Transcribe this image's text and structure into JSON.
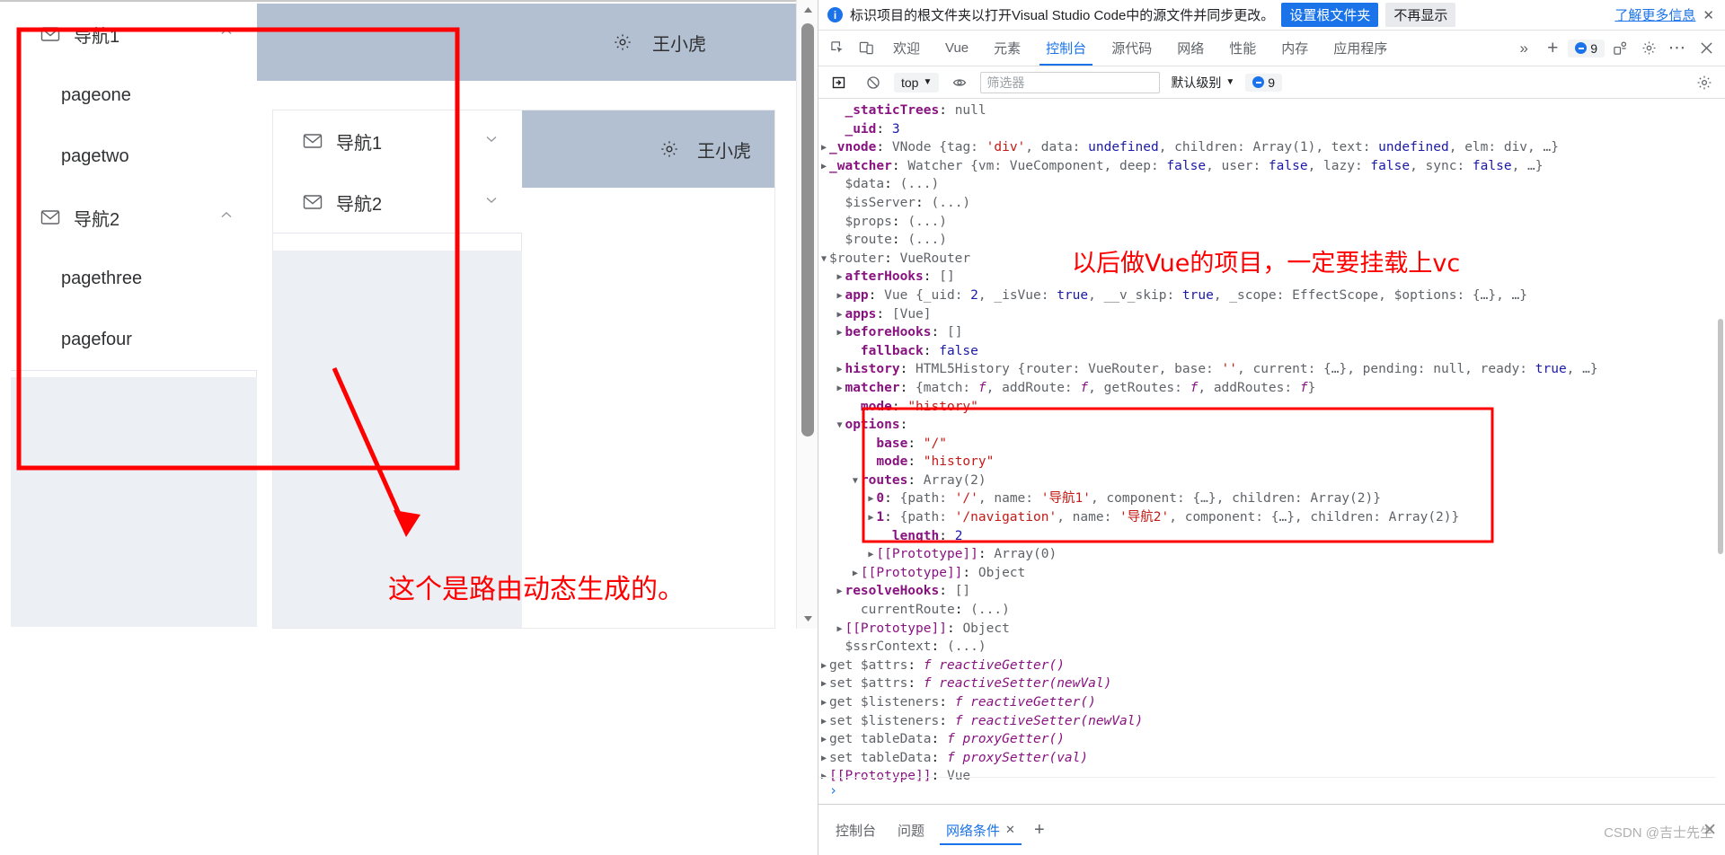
{
  "browser_page": {
    "outer_app": {
      "menu": [
        {
          "type": "group",
          "label": "导航1",
          "icon": "mail-icon",
          "arrow": "chevron-up-icon"
        },
        {
          "type": "leaf",
          "label": "pageone"
        },
        {
          "type": "leaf",
          "label": "pagetwo"
        },
        {
          "type": "group",
          "label": "导航2",
          "icon": "mail-icon",
          "arrow": "chevron-up-icon"
        },
        {
          "type": "leaf",
          "label": "pagethree"
        },
        {
          "type": "leaf",
          "label": "pagefour"
        }
      ],
      "header": {
        "gear_icon": "gear-icon",
        "user_name": "王小虎"
      }
    },
    "inner_app": {
      "menu": [
        {
          "type": "group",
          "label": "导航1",
          "icon": "mail-icon",
          "arrow": "chevron-down-icon"
        },
        {
          "type": "group",
          "label": "导航2",
          "icon": "mail-icon",
          "arrow": "chevron-down-icon"
        }
      ],
      "header": {
        "gear_icon": "gear-icon",
        "user_name": "王小虎"
      }
    },
    "annotations": {
      "dynamic_route_note": "这个是路由动态生成的。",
      "highlight_color": "#ff0000"
    }
  },
  "devtools": {
    "banner": {
      "info_icon": "info-icon",
      "message": "标识项目的根文件夹以打开Visual Studio Code中的源文件并同步更改。",
      "primary_button": "设置根文件夹",
      "secondary_button": "不再显示",
      "learn_more": "了解更多信息",
      "close": "✕"
    },
    "tabs": {
      "left_icons": [
        "inspect-icon",
        "device-toolbar-icon"
      ],
      "items": [
        {
          "label": "欢迎",
          "active": false
        },
        {
          "label": "Vue",
          "active": false
        },
        {
          "label": "元素",
          "active": false
        },
        {
          "label": "控制台",
          "active": true
        },
        {
          "label": "源代码",
          "active": false
        },
        {
          "label": "网络",
          "active": false
        },
        {
          "label": "性能",
          "active": false
        },
        {
          "label": "内存",
          "active": false
        },
        {
          "label": "应用程序",
          "active": false
        }
      ],
      "overflow": "»",
      "add": "+",
      "issues_count": "9",
      "right_icons": [
        "devices-icon",
        "settings-gear-icon",
        "more-dots-icon",
        "close-icon"
      ]
    },
    "console_toolbar": {
      "clear_icon": "clear-console-icon",
      "no_entry_icon": "no-entry-icon",
      "context": "top",
      "eye_icon": "live-expression-icon",
      "filter_placeholder": "筛选器",
      "filter_value": "",
      "level": "默认级别",
      "issues_count": "9",
      "settings_icon": "settings-gear-icon"
    },
    "console_lines": [
      {
        "indent": 1,
        "tri": "none",
        "key": "_staticTrees",
        "kstyle": "own",
        "sep": ": ",
        "parts": [
          {
            "t": "null",
            "c": "v-null"
          }
        ]
      },
      {
        "indent": 1,
        "tri": "none",
        "key": "_uid",
        "kstyle": "own",
        "sep": ": ",
        "parts": [
          {
            "t": "3",
            "c": "v-num"
          }
        ]
      },
      {
        "indent": 0,
        "tri": "closed",
        "key": "_vnode",
        "kstyle": "own",
        "sep": ": ",
        "parts": [
          {
            "t": "VNode ",
            "c": "v-obj"
          },
          {
            "t": "{tag: ",
            "c": "v-obj"
          },
          {
            "t": "'div'",
            "c": "v-str"
          },
          {
            "t": ", data: ",
            "c": "v-obj"
          },
          {
            "t": "undefined",
            "c": "v-kw"
          },
          {
            "t": ", children: Array(1), text: ",
            "c": "v-obj"
          },
          {
            "t": "undefined",
            "c": "v-kw"
          },
          {
            "t": ", elm: div, …}",
            "c": "v-obj"
          }
        ]
      },
      {
        "indent": 0,
        "tri": "closed",
        "key": "_watcher",
        "kstyle": "own",
        "sep": ": ",
        "parts": [
          {
            "t": "Watcher ",
            "c": "v-obj"
          },
          {
            "t": "{vm: VueComponent, deep: ",
            "c": "v-obj"
          },
          {
            "t": "false",
            "c": "v-kw"
          },
          {
            "t": ", user: ",
            "c": "v-obj"
          },
          {
            "t": "false",
            "c": "v-kw"
          },
          {
            "t": ", lazy: ",
            "c": "v-obj"
          },
          {
            "t": "false",
            "c": "v-kw"
          },
          {
            "t": ", sync: ",
            "c": "v-obj"
          },
          {
            "t": "false",
            "c": "v-kw"
          },
          {
            "t": ", …}",
            "c": "v-obj"
          }
        ]
      },
      {
        "indent": 1,
        "tri": "none",
        "key": "$data",
        "kstyle": "gray",
        "sep": ": ",
        "parts": [
          {
            "t": "(...)",
            "c": "k-gray"
          }
        ]
      },
      {
        "indent": 1,
        "tri": "none",
        "key": "$isServer",
        "kstyle": "gray",
        "sep": ": ",
        "parts": [
          {
            "t": "(...)",
            "c": "k-gray"
          }
        ]
      },
      {
        "indent": 1,
        "tri": "none",
        "key": "$props",
        "kstyle": "gray",
        "sep": ": ",
        "parts": [
          {
            "t": "(...)",
            "c": "k-gray"
          }
        ]
      },
      {
        "indent": 1,
        "tri": "none",
        "key": "$route",
        "kstyle": "gray",
        "sep": ": ",
        "parts": [
          {
            "t": "(...)",
            "c": "k-gray"
          }
        ]
      },
      {
        "indent": 0,
        "tri": "open",
        "key": "$router",
        "kstyle": "gray",
        "sep": ": ",
        "parts": [
          {
            "t": "VueRouter",
            "c": "v-obj"
          }
        ]
      },
      {
        "indent": 1,
        "tri": "closed",
        "key": "afterHooks",
        "kstyle": "own",
        "sep": ": ",
        "parts": [
          {
            "t": "[]",
            "c": "v-obj"
          }
        ]
      },
      {
        "indent": 1,
        "tri": "closed",
        "key": "app",
        "kstyle": "own",
        "sep": ": ",
        "parts": [
          {
            "t": "Vue ",
            "c": "v-obj"
          },
          {
            "t": "{_uid: ",
            "c": "v-obj"
          },
          {
            "t": "2",
            "c": "v-num"
          },
          {
            "t": ", _isVue: ",
            "c": "v-obj"
          },
          {
            "t": "true",
            "c": "v-kw"
          },
          {
            "t": ", __v_skip: ",
            "c": "v-obj"
          },
          {
            "t": "true",
            "c": "v-kw"
          },
          {
            "t": ", _scope: EffectScope, $options: {…}, …}",
            "c": "v-obj"
          }
        ]
      },
      {
        "indent": 1,
        "tri": "closed",
        "key": "apps",
        "kstyle": "own",
        "sep": ": ",
        "parts": [
          {
            "t": "[Vue]",
            "c": "v-obj"
          }
        ]
      },
      {
        "indent": 1,
        "tri": "closed",
        "key": "beforeHooks",
        "kstyle": "own",
        "sep": ": ",
        "parts": [
          {
            "t": "[]",
            "c": "v-obj"
          }
        ]
      },
      {
        "indent": 2,
        "tri": "none",
        "key": "fallback",
        "kstyle": "own",
        "sep": ": ",
        "parts": [
          {
            "t": "false",
            "c": "v-kw"
          }
        ]
      },
      {
        "indent": 1,
        "tri": "closed",
        "key": "history",
        "kstyle": "own",
        "sep": ": ",
        "parts": [
          {
            "t": "HTML5History ",
            "c": "v-obj"
          },
          {
            "t": "{router: VueRouter, base: ",
            "c": "v-obj"
          },
          {
            "t": "''",
            "c": "v-str"
          },
          {
            "t": ", current: {…}, pending: ",
            "c": "v-obj"
          },
          {
            "t": "null",
            "c": "v-null"
          },
          {
            "t": ", ready: ",
            "c": "v-obj"
          },
          {
            "t": "true",
            "c": "v-kw"
          },
          {
            "t": ", …}",
            "c": "v-obj"
          }
        ]
      },
      {
        "indent": 1,
        "tri": "closed",
        "key": "matcher",
        "kstyle": "own",
        "sep": ": ",
        "parts": [
          {
            "t": "{match: ",
            "c": "v-obj"
          },
          {
            "t": "f",
            "c": "fn-mark"
          },
          {
            "t": ", addRoute: ",
            "c": "v-obj"
          },
          {
            "t": "f",
            "c": "fn-mark"
          },
          {
            "t": ", getRoutes: ",
            "c": "v-obj"
          },
          {
            "t": "f",
            "c": "fn-mark"
          },
          {
            "t": ", addRoutes: ",
            "c": "v-obj"
          },
          {
            "t": "f",
            "c": "fn-mark"
          },
          {
            "t": "}",
            "c": "v-obj"
          }
        ]
      },
      {
        "indent": 2,
        "tri": "none",
        "key": "mode",
        "kstyle": "own",
        "sep": ": ",
        "parts": [
          {
            "t": "\"history\"",
            "c": "v-str"
          }
        ]
      },
      {
        "indent": 1,
        "tri": "open",
        "key": "options",
        "kstyle": "own",
        "sep": ":",
        "parts": []
      },
      {
        "indent": 3,
        "tri": "none",
        "key": "base",
        "kstyle": "own",
        "sep": ": ",
        "parts": [
          {
            "t": "\"/\"",
            "c": "v-str"
          }
        ]
      },
      {
        "indent": 3,
        "tri": "none",
        "key": "mode",
        "kstyle": "own",
        "sep": ": ",
        "parts": [
          {
            "t": "\"history\"",
            "c": "v-str"
          }
        ]
      },
      {
        "indent": 2,
        "tri": "open",
        "key": "routes",
        "kstyle": "own",
        "sep": ": ",
        "parts": [
          {
            "t": "Array(2)",
            "c": "v-obj"
          }
        ]
      },
      {
        "indent": 3,
        "tri": "closed",
        "key": "0",
        "kstyle": "own",
        "sep": ": ",
        "parts": [
          {
            "t": "{path: ",
            "c": "v-obj"
          },
          {
            "t": "'/'",
            "c": "v-str"
          },
          {
            "t": ", name: ",
            "c": "v-obj"
          },
          {
            "t": "'导航1'",
            "c": "v-str"
          },
          {
            "t": ", component: {…}, children: Array(2)}",
            "c": "v-obj"
          }
        ]
      },
      {
        "indent": 3,
        "tri": "closed",
        "key": "1",
        "kstyle": "own",
        "sep": ": ",
        "parts": [
          {
            "t": "{path: ",
            "c": "v-obj"
          },
          {
            "t": "'/navigation'",
            "c": "v-str"
          },
          {
            "t": ", name: ",
            "c": "v-obj"
          },
          {
            "t": "'导航2'",
            "c": "v-str"
          },
          {
            "t": ", component: {…}, children: Array(2)}",
            "c": "v-obj"
          }
        ]
      },
      {
        "indent": 4,
        "tri": "none",
        "key": "length",
        "kstyle": "own",
        "sep": ": ",
        "parts": [
          {
            "t": "2",
            "c": "v-num"
          }
        ]
      },
      {
        "indent": 3,
        "tri": "closed",
        "key": "[[Prototype]]",
        "kstyle": "proto",
        "sep": ": ",
        "parts": [
          {
            "t": "Array(0)",
            "c": "v-obj"
          }
        ]
      },
      {
        "indent": 2,
        "tri": "closed",
        "key": "[[Prototype]]",
        "kstyle": "proto",
        "sep": ": ",
        "parts": [
          {
            "t": "Object",
            "c": "v-obj"
          }
        ]
      },
      {
        "indent": 1,
        "tri": "closed",
        "key": "resolveHooks",
        "kstyle": "own",
        "sep": ": ",
        "parts": [
          {
            "t": "[]",
            "c": "v-obj"
          }
        ]
      },
      {
        "indent": 2,
        "tri": "none",
        "key": "currentRoute",
        "kstyle": "gray",
        "sep": ": ",
        "parts": [
          {
            "t": "(...)",
            "c": "k-gray"
          }
        ]
      },
      {
        "indent": 1,
        "tri": "closed",
        "key": "[[Prototype]]",
        "kstyle": "proto",
        "sep": ": ",
        "parts": [
          {
            "t": "Object",
            "c": "v-obj"
          }
        ]
      },
      {
        "indent": 1,
        "tri": "none",
        "key": "$ssrContext",
        "kstyle": "gray",
        "sep": ": ",
        "parts": [
          {
            "t": "(...)",
            "c": "k-gray"
          }
        ]
      },
      {
        "indent": 0,
        "tri": "closed",
        "key": "get $attrs",
        "kstyle": "gray",
        "sep": ": ",
        "parts": [
          {
            "t": "f ",
            "c": "fn-mark"
          },
          {
            "t": "reactiveGetter()",
            "c": "v-fn"
          }
        ]
      },
      {
        "indent": 0,
        "tri": "closed",
        "key": "set $attrs",
        "kstyle": "gray",
        "sep": ": ",
        "parts": [
          {
            "t": "f ",
            "c": "fn-mark"
          },
          {
            "t": "reactiveSetter(newVal)",
            "c": "v-fn"
          }
        ]
      },
      {
        "indent": 0,
        "tri": "closed",
        "key": "get $listeners",
        "kstyle": "gray",
        "sep": ": ",
        "parts": [
          {
            "t": "f ",
            "c": "fn-mark"
          },
          {
            "t": "reactiveGetter()",
            "c": "v-fn"
          }
        ]
      },
      {
        "indent": 0,
        "tri": "closed",
        "key": "set $listeners",
        "kstyle": "gray",
        "sep": ": ",
        "parts": [
          {
            "t": "f ",
            "c": "fn-mark"
          },
          {
            "t": "reactiveSetter(newVal)",
            "c": "v-fn"
          }
        ]
      },
      {
        "indent": 0,
        "tri": "closed",
        "key": "get tableData",
        "kstyle": "gray",
        "sep": ": ",
        "parts": [
          {
            "t": "f ",
            "c": "fn-mark"
          },
          {
            "t": "proxyGetter()",
            "c": "v-fn"
          }
        ]
      },
      {
        "indent": 0,
        "tri": "closed",
        "key": "set tableData",
        "kstyle": "gray",
        "sep": ": ",
        "parts": [
          {
            "t": "f ",
            "c": "fn-mark"
          },
          {
            "t": "proxySetter(val)",
            "c": "v-fn"
          }
        ]
      },
      {
        "indent": 0,
        "tri": "closed",
        "key": "[[Prototype]]",
        "kstyle": "proto",
        "sep": ": ",
        "parts": [
          {
            "t": "Vue",
            "c": "v-obj"
          }
        ]
      }
    ],
    "prompt_symbol": "›",
    "drawer": {
      "tabs": [
        {
          "label": "控制台",
          "active": false,
          "closable": false
        },
        {
          "label": "问题",
          "active": false,
          "closable": false
        },
        {
          "label": "网络条件",
          "active": true,
          "closable": true,
          "close": "✕"
        }
      ],
      "add": "+"
    },
    "watermark": "CSDN @吉士先生",
    "annotation": {
      "note": "以后做Vue的项目，一定要挂载上vc",
      "highlight_color": "#ff0000"
    }
  }
}
